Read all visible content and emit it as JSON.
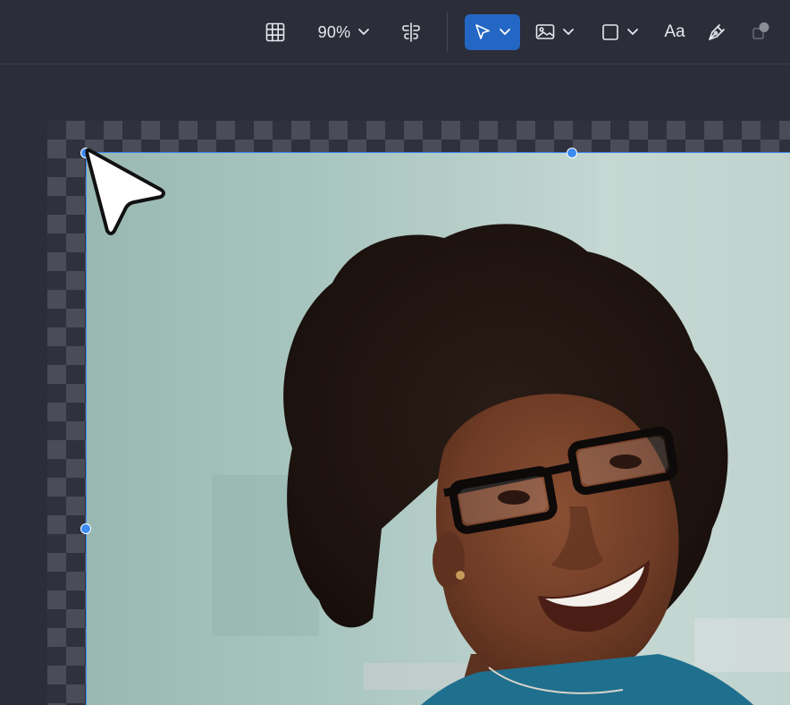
{
  "toolbar": {
    "zoom_label": "90%",
    "text_tool_label": "Aa",
    "icons": {
      "grid": "grid-icon",
      "zoom_chevron": "chevron-down-icon",
      "align": "align-center-icon",
      "select": "pointer-arrow-icon",
      "image": "image-icon",
      "shape": "square-icon",
      "pen": "pen-nib-icon",
      "fill": "fill-color-icon"
    },
    "accent_color": "#2466c4"
  },
  "canvas": {
    "selection_color": "#3d8bf2",
    "background": "#2b2d39",
    "image_subject": "portrait-photo"
  }
}
